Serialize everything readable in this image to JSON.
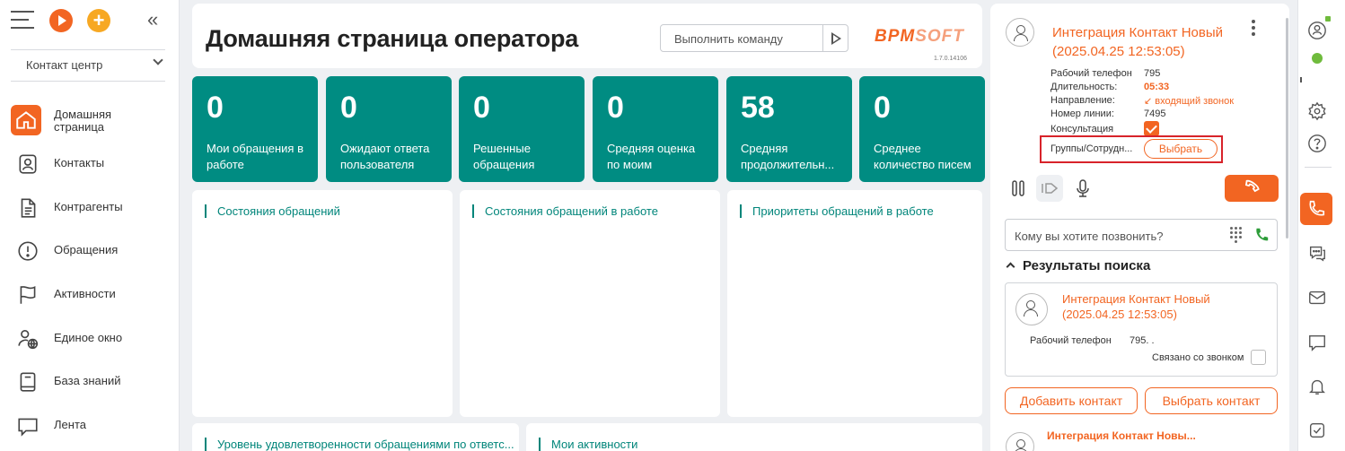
{
  "sidebar": {
    "section_selector": "Контакт центр",
    "items": [
      {
        "label_line1": "Домашняя",
        "label_line2": "страница",
        "icon": "home-icon",
        "active": true
      },
      {
        "label": "Контакты",
        "icon": "contact-card-icon"
      },
      {
        "label": "Контрагенты",
        "icon": "document-icon"
      },
      {
        "label": "Обращения",
        "icon": "alert-circle-icon"
      },
      {
        "label": "Активности",
        "icon": "flag-icon"
      },
      {
        "label": "Единое окно",
        "icon": "user-globe-icon"
      },
      {
        "label": "База знаний",
        "icon": "book-icon"
      },
      {
        "label": "Лента",
        "icon": "chat-bubble-icon"
      }
    ]
  },
  "header": {
    "title": "Домашняя страница оператора",
    "command_placeholder": "Выполнить команду",
    "logo_main": "BPM",
    "logo_soft": "SOFT",
    "version": "1.7.0.14106"
  },
  "kpis": [
    {
      "value": "0",
      "label_line1": "Мои обращения в",
      "label_line2": "работе"
    },
    {
      "value": "0",
      "label_line1": "Ожидают ответа",
      "label_line2": "пользователя"
    },
    {
      "value": "0",
      "label_line1": "Решенные",
      "label_line2": "обращения"
    },
    {
      "value": "0",
      "label_line1": "Средняя оценка",
      "label_line2": "по моим"
    },
    {
      "value": "58",
      "label_line1": "Средняя",
      "label_line2": "продолжительн..."
    },
    {
      "value": "0",
      "label_line1": "Среднее",
      "label_line2": "количество писем"
    }
  ],
  "widgets": {
    "w1": "Состояния обращений",
    "w2": "Состояния обращений в работе",
    "w3": "Приоритеты обращений в работе",
    "w4": "Уровень удовлетворенности обращениями по ответс...",
    "w5": "Мои активности"
  },
  "call": {
    "contact_name_line1": "Интеграция Контакт Новый",
    "contact_name_line2": "(2025.04.25 12:53:05)",
    "fields": {
      "work_phone_label": "Рабочий телефон",
      "work_phone_value": "795",
      "duration_label": "Длительность:",
      "duration_value": "05:33",
      "direction_label": "Направление:",
      "direction_value": "входящий звонок",
      "line_label": "Номер линии:",
      "line_value": "7495",
      "consultation_label": "Консультация",
      "groups_label": "Группы/Сотрудн...",
      "choose_button": "Выбрать"
    },
    "dial_placeholder": "Кому вы хотите позвонить?"
  },
  "search_results": {
    "title": "Результаты поиска",
    "result": {
      "name_line1": "Интеграция Контакт Новый",
      "name_line2": "(2025.04.25 12:53:05)",
      "work_phone_label": "Рабочий телефон",
      "work_phone_value": "795. .",
      "linked_label": "Связано со звонком"
    },
    "add_contact_button": "Добавить контакт",
    "choose_contact_button": "Выбрать контакт",
    "next_contact": "Интеграция Контакт Новы..."
  },
  "colors": {
    "accent": "#f26522",
    "teal": "#008c82",
    "status_online": "#6fbb3c",
    "highlight": "#d8232a"
  }
}
